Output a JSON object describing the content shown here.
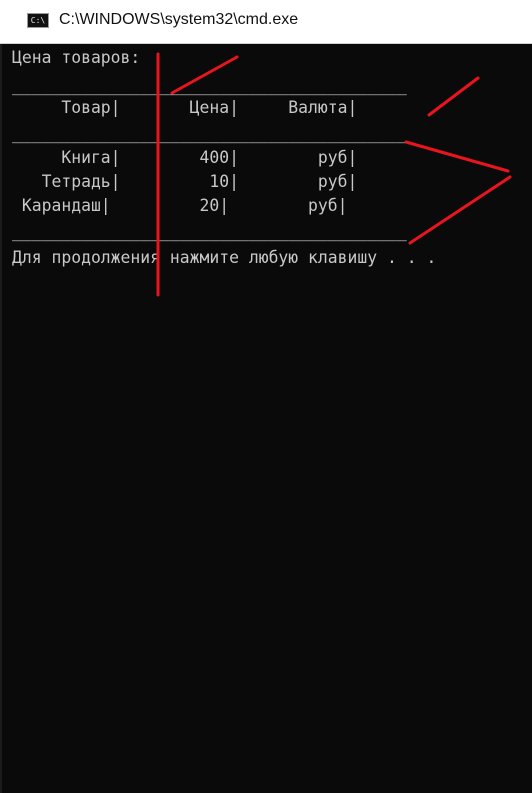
{
  "window": {
    "title": "C:\\WINDOWS\\system32\\cmd.exe",
    "icon": "cmd-window-icon",
    "icon_text": "C:\\"
  },
  "console": {
    "heading": "Цена товаров:",
    "rule": "________________________________________",
    "header_row": "     Товар|       Цена|     Валюта|",
    "rows": [
      "     Книга|        400|        руб|",
      "   Тетрадь|         10|        руб|",
      " Карандаш|         20|        руб|"
    ],
    "prompt": "Для продолжения нажмите любую клавишу . . ."
  },
  "colors": {
    "console_background": "#0a0a0a",
    "console_text": "#c8c8c8",
    "annotation_red": "#e8141e",
    "titlebar_background": "#ffffff"
  }
}
